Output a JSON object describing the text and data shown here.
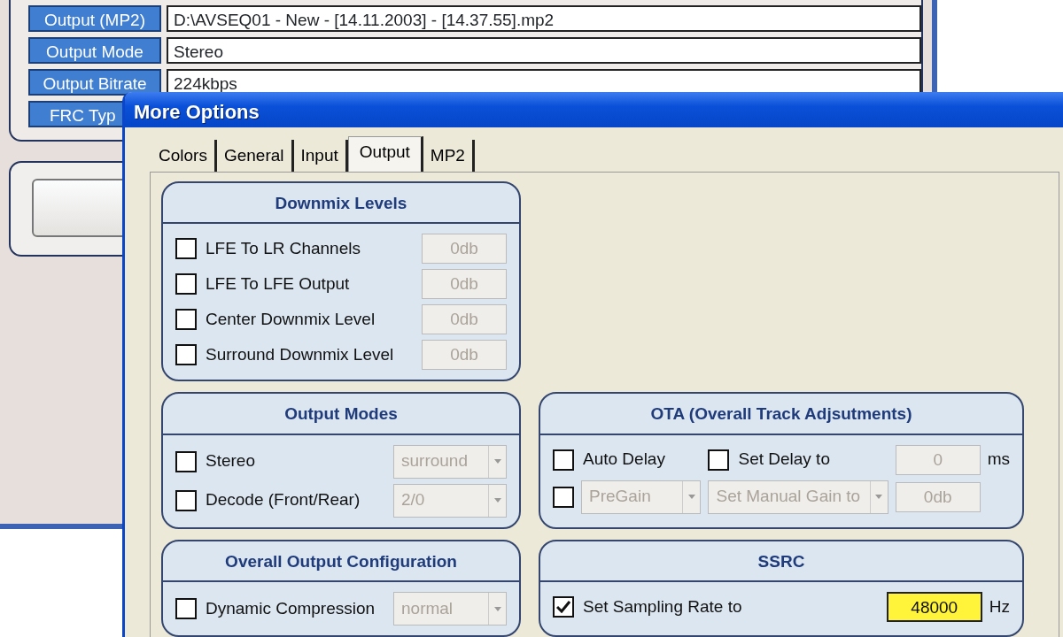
{
  "background_window": {
    "rows": [
      {
        "label": "Output (MP2)",
        "value": "D:\\AVSEQ01 - New - [14.11.2003] - [14.37.55].mp2"
      },
      {
        "label": "Output Mode",
        "value": "Stereo"
      },
      {
        "label": "Output Bitrate",
        "value": "224kbps"
      },
      {
        "label": "FRC Typ"
      }
    ]
  },
  "dialog": {
    "title": "More Options",
    "tabs": [
      {
        "label": "Colors",
        "selected": false
      },
      {
        "label": "General",
        "selected": false
      },
      {
        "label": "Input",
        "selected": false
      },
      {
        "label": "Output",
        "selected": true
      },
      {
        "label": "MP2",
        "selected": false
      }
    ],
    "groups": [
      {
        "title": "Downmix Levels",
        "rows": [
          [
            {
              "kind": "checkbox",
              "label": "LFE To LR Channels",
              "checked": false
            },
            {
              "kind": "field",
              "value": "0db",
              "disabled": true
            }
          ],
          [
            {
              "kind": "checkbox",
              "label": "LFE To LFE Output",
              "checked": false
            },
            {
              "kind": "field",
              "value": "0db",
              "disabled": true
            }
          ],
          [
            {
              "kind": "checkbox",
              "label": "Center Downmix Level",
              "checked": false
            },
            {
              "kind": "field",
              "value": "0db",
              "disabled": true
            }
          ],
          [
            {
              "kind": "checkbox",
              "label": "Surround Downmix Level",
              "checked": false
            },
            {
              "kind": "field",
              "value": "0db",
              "disabled": true
            }
          ]
        ]
      },
      {
        "title": "Output Modes",
        "rows": [
          [
            {
              "kind": "checkbox",
              "label": "Stereo",
              "checked": false
            },
            {
              "kind": "select",
              "value": "surround",
              "disabled": true
            }
          ],
          [
            {
              "kind": "checkbox",
              "label": "Decode (Front/Rear)",
              "checked": false
            },
            {
              "kind": "select",
              "value": "2/0",
              "disabled": true
            }
          ]
        ]
      },
      {
        "title": "OTA (Overall Track Adjsutments)",
        "rows": [
          [
            {
              "kind": "checkbox",
              "label": "Auto Delay",
              "checked": false
            },
            "",
            {
              "kind": "checkbox",
              "label": "Set Delay to",
              "checked": false
            },
            {
              "kind": "field",
              "value": "0",
              "disabled": true
            },
            {
              "kind": "text",
              "label": "ms"
            }
          ],
          [
            {
              "kind": "checkbox",
              "checked": false
            },
            {
              "kind": "select",
              "value": "PreGain",
              "disabled": true
            },
            {
              "kind": "select",
              "value": "Set Manual Gain to",
              "disabled": true
            },
            {
              "kind": "field",
              "value": "0db",
              "disabled": true
            }
          ]
        ]
      },
      {
        "title": "Overall Output Configuration",
        "rows": [
          [
            {
              "kind": "checkbox",
              "label": "Dynamic Compression",
              "checked": false
            },
            {
              "kind": "select",
              "value": "normal",
              "disabled": true
            }
          ]
        ]
      },
      {
        "title": "SSRC",
        "rows": [
          [
            {
              "kind": "checkbox",
              "label": "Set Sampling Rate to",
              "checked": true
            },
            {
              "kind": "field",
              "value": "48000",
              "highlighted": true
            },
            {
              "kind": "text",
              "label": "Hz"
            }
          ]
        ]
      }
    ]
  }
}
